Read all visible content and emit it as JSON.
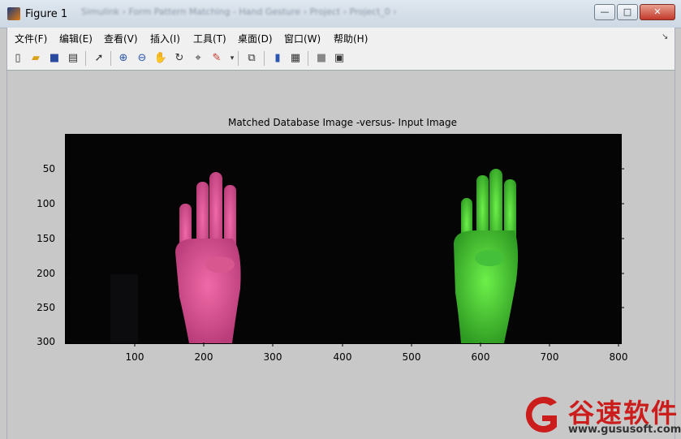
{
  "window": {
    "title": "Figure 1",
    "background_title_blur": "Simulink   ›  Form Pattern Matching - Hand Gesture  ›  Project  ›  Project_0  ›",
    "controls": {
      "minimize": "—",
      "maximize": "□",
      "close": "✕"
    }
  },
  "menu": {
    "items": [
      "文件(F)",
      "编辑(E)",
      "查看(V)",
      "插入(I)",
      "工具(T)",
      "桌面(D)",
      "窗口(W)",
      "帮助(H)"
    ],
    "overflow_icon": "↘"
  },
  "toolbar": {
    "icons": [
      "new-figure-icon",
      "open-file-icon",
      "save-icon",
      "print-icon",
      "pointer-icon",
      "zoom-in-icon",
      "zoom-out-icon",
      "pan-icon",
      "rotate-3d-icon",
      "data-cursor-icon",
      "brush-icon",
      "link-icon",
      "colorbar-icon",
      "legend-icon",
      "hide-plot-tools-icon",
      "show-plot-tools-icon"
    ]
  },
  "axes": {
    "title": "Matched Database Image -versus- Input Image",
    "yticks": [
      "50",
      "100",
      "150",
      "200",
      "250",
      "300"
    ],
    "xticks": [
      "100",
      "200",
      "300",
      "400",
      "500",
      "600",
      "700",
      "800"
    ]
  },
  "watermark": {
    "text": "谷速软件",
    "url": "www.gususoft.com",
    "color": "#cc1d1d"
  }
}
